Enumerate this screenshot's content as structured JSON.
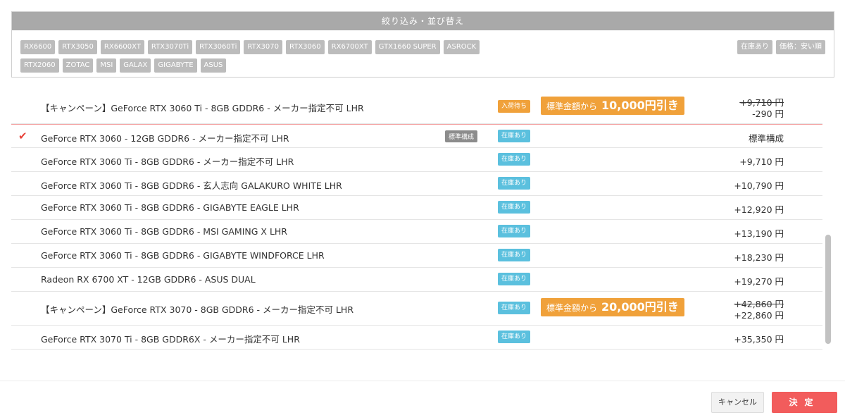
{
  "filter": {
    "title": "絞り込み・並び替え",
    "chips_row1": [
      "RX6600",
      "RTX3050",
      "RX6600XT",
      "RTX3070Ti",
      "RTX3060Ti",
      "RTX3070",
      "RTX3060",
      "RX6700XT",
      "GTX1660 SUPER",
      "ASROCK"
    ],
    "chips_row2": [
      "RTX2060",
      "ZOTAC",
      "MSI",
      "GALAX",
      "GIGABYTE",
      "ASUS"
    ],
    "chips_right": [
      "在庫あり",
      "価格：安い順"
    ]
  },
  "rows": [
    {
      "name": "【キャンペーン】GeForce RTX 3060 Ti - 8GB GDDR6 - メーカー指定不可 LHR",
      "stock": "入荷待ち",
      "promo_pre": "標準金額から",
      "promo_amount": "10,000円引き",
      "price_old": "+9,710 円",
      "price_new": "-290 円"
    },
    {
      "name": "GeForce RTX 3060 - 12GB GDDR6 - メーカー指定不可 LHR",
      "std": "標準構成",
      "stock": "在庫あり",
      "price": "標準構成"
    },
    {
      "name": "GeForce RTX 3060 Ti - 8GB GDDR6 - メーカー指定不可 LHR",
      "stock": "在庫あり",
      "price": "+9,710 円"
    },
    {
      "name": "GeForce RTX 3060 Ti - 8GB GDDR6 - 玄人志向 GALAKURO WHITE LHR",
      "stock": "在庫あり",
      "price": "+10,790 円"
    },
    {
      "name": "GeForce RTX 3060 Ti - 8GB GDDR6 - GIGABYTE EAGLE LHR",
      "stock": "在庫あり",
      "price": "+12,920 円"
    },
    {
      "name": "GeForce RTX 3060 Ti - 8GB GDDR6 - MSI GAMING X LHR",
      "stock": "在庫あり",
      "price": "+13,190 円"
    },
    {
      "name": "GeForce RTX 3060 Ti - 8GB GDDR6 - GIGABYTE WINDFORCE LHR",
      "stock": "在庫あり",
      "price": "+18,230 円"
    },
    {
      "name": "Radeon RX 6700 XT - 12GB GDDR6 - ASUS DUAL",
      "stock": "在庫あり",
      "price": "+19,270 円"
    },
    {
      "name": "【キャンペーン】GeForce RTX 3070 - 8GB GDDR6 - メーカー指定不可 LHR",
      "stock": "在庫あり",
      "promo_pre": "標準金額から",
      "promo_amount": "20,000円引き",
      "price_old": "+42,860 円",
      "price_new": "+22,860 円"
    },
    {
      "name": "GeForce RTX 3070 Ti - 8GB GDDR6X - メーカー指定不可 LHR",
      "stock": "在庫あり",
      "price": "+35,350 円"
    }
  ],
  "footer": {
    "cancel_label": "キャンセル",
    "ok_label": "決定"
  },
  "colors": {
    "instock": "#5bc0de",
    "waiting": "#f0a13a",
    "accent": "#f25c5c",
    "check": "#e8453c"
  }
}
